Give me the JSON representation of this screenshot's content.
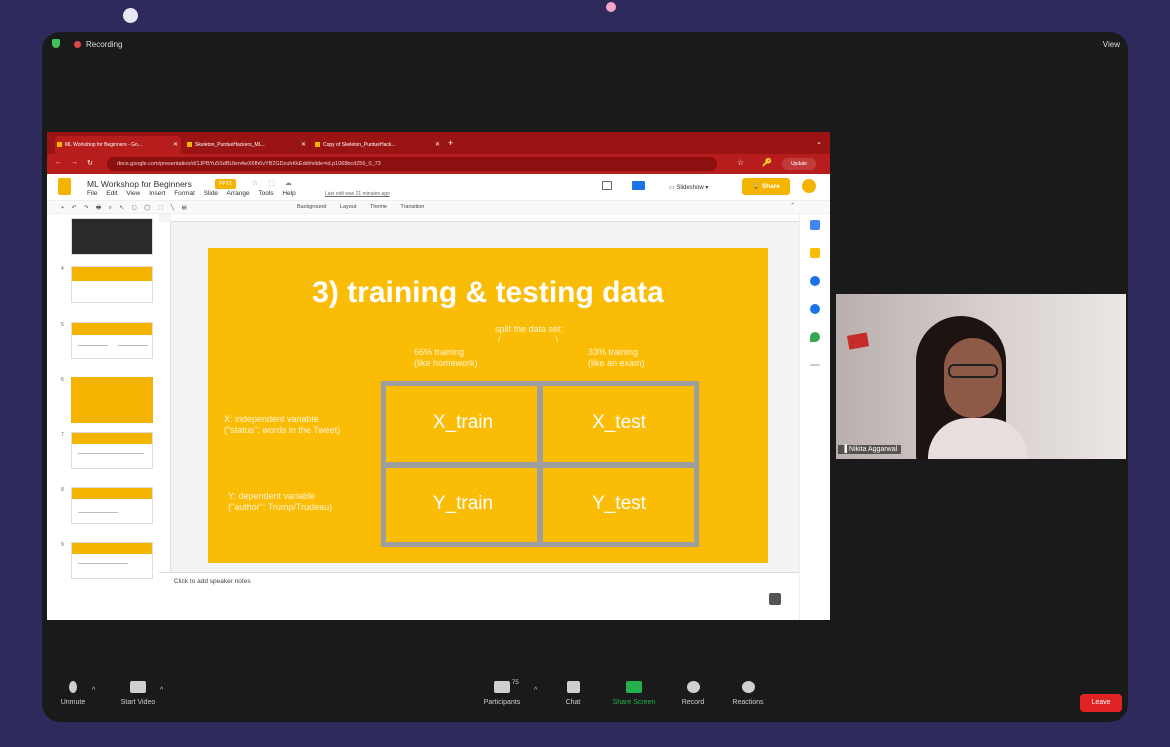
{
  "zoom": {
    "recording_label": "Recording",
    "view_label": "View",
    "participant_count": "75",
    "participant_name": "Nikita Aggarwal",
    "controls": [
      "Unmute",
      "Start Video",
      "Participants",
      "Chat",
      "Share Screen",
      "Record",
      "Reactions"
    ],
    "leave_label": "Leave"
  },
  "browser": {
    "tabs": [
      "ML Workshop for Beginners - Go...",
      "Skeleton_PurdueHackers_ML...",
      "Copy of Skeleton_PurdueHack..."
    ],
    "url": "docs.google.com/presentation/d/1JPBYu5SdBUkm4wX6fh6vYB2GDzuhKkEdd#slide=id.p1068bcd256_0_73",
    "update_label": "Update"
  },
  "docs": {
    "title": "ML Workshop for Beginners",
    "badge": "PPTX",
    "menus": [
      "File",
      "Edit",
      "View",
      "Insert",
      "Format",
      "Slide",
      "Arrange",
      "Tools",
      "Help"
    ],
    "last_edit": "Last edit was 21 minutes ago",
    "slideshow_label": "Slideshow",
    "share_label": "Share",
    "toolbar_opts": [
      "Background",
      "Layout",
      "Theme",
      "Transition"
    ],
    "notes_placeholder": "Click to add speaker notes",
    "thumb_numbers": [
      "4",
      "5",
      "6",
      "7",
      "8",
      "9"
    ]
  },
  "slide": {
    "title": "3) training & testing data",
    "split_note": "split the data set:",
    "train_note_1": "66% training",
    "train_note_2": "(like homework)",
    "test_note_1": "33% training",
    "test_note_2": "(like an exam)",
    "x_desc_1": "X: independent variable",
    "x_desc_2": "(\"status\": words in the Tweet)",
    "y_desc_1": "Y: dependent variable",
    "y_desc_2": "(\"author\": Trump/Trudeau)",
    "cells": [
      "X_train",
      "X_test",
      "Y_train",
      "Y_test"
    ]
  },
  "colors": {
    "slide_bg": "#fbbc05",
    "browser_accent": "#b81d1d",
    "zoom_bg": "#2e2a5c",
    "leave_red": "#e02424",
    "share_green": "#22b14c"
  }
}
